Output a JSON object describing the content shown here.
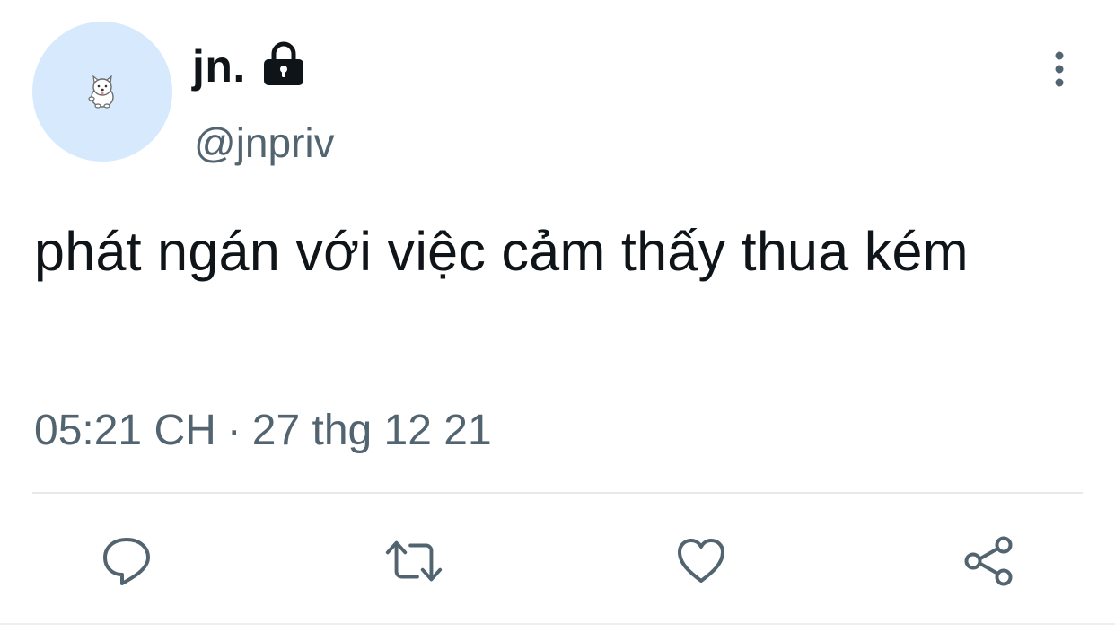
{
  "user": {
    "display_name": "jn.",
    "handle": "@jnpriv",
    "protected_icon": "lock-icon",
    "avatar_icon": "dog-icon"
  },
  "tweet": {
    "text": "phát ngán với việc cảm thấy thua kém",
    "time": "05:21 CH",
    "separator": "·",
    "date": "27 thg 12 21"
  },
  "actions": [
    {
      "name": "reply",
      "icon": "reply-icon"
    },
    {
      "name": "retweet",
      "icon": "retweet-icon"
    },
    {
      "name": "like",
      "icon": "heart-icon"
    },
    {
      "name": "share",
      "icon": "share-icon"
    }
  ],
  "colors": {
    "text": "#0f1419",
    "secondary": "#536471",
    "avatar_bg": "#d6e9fd",
    "divider": "#e7e9ec"
  }
}
